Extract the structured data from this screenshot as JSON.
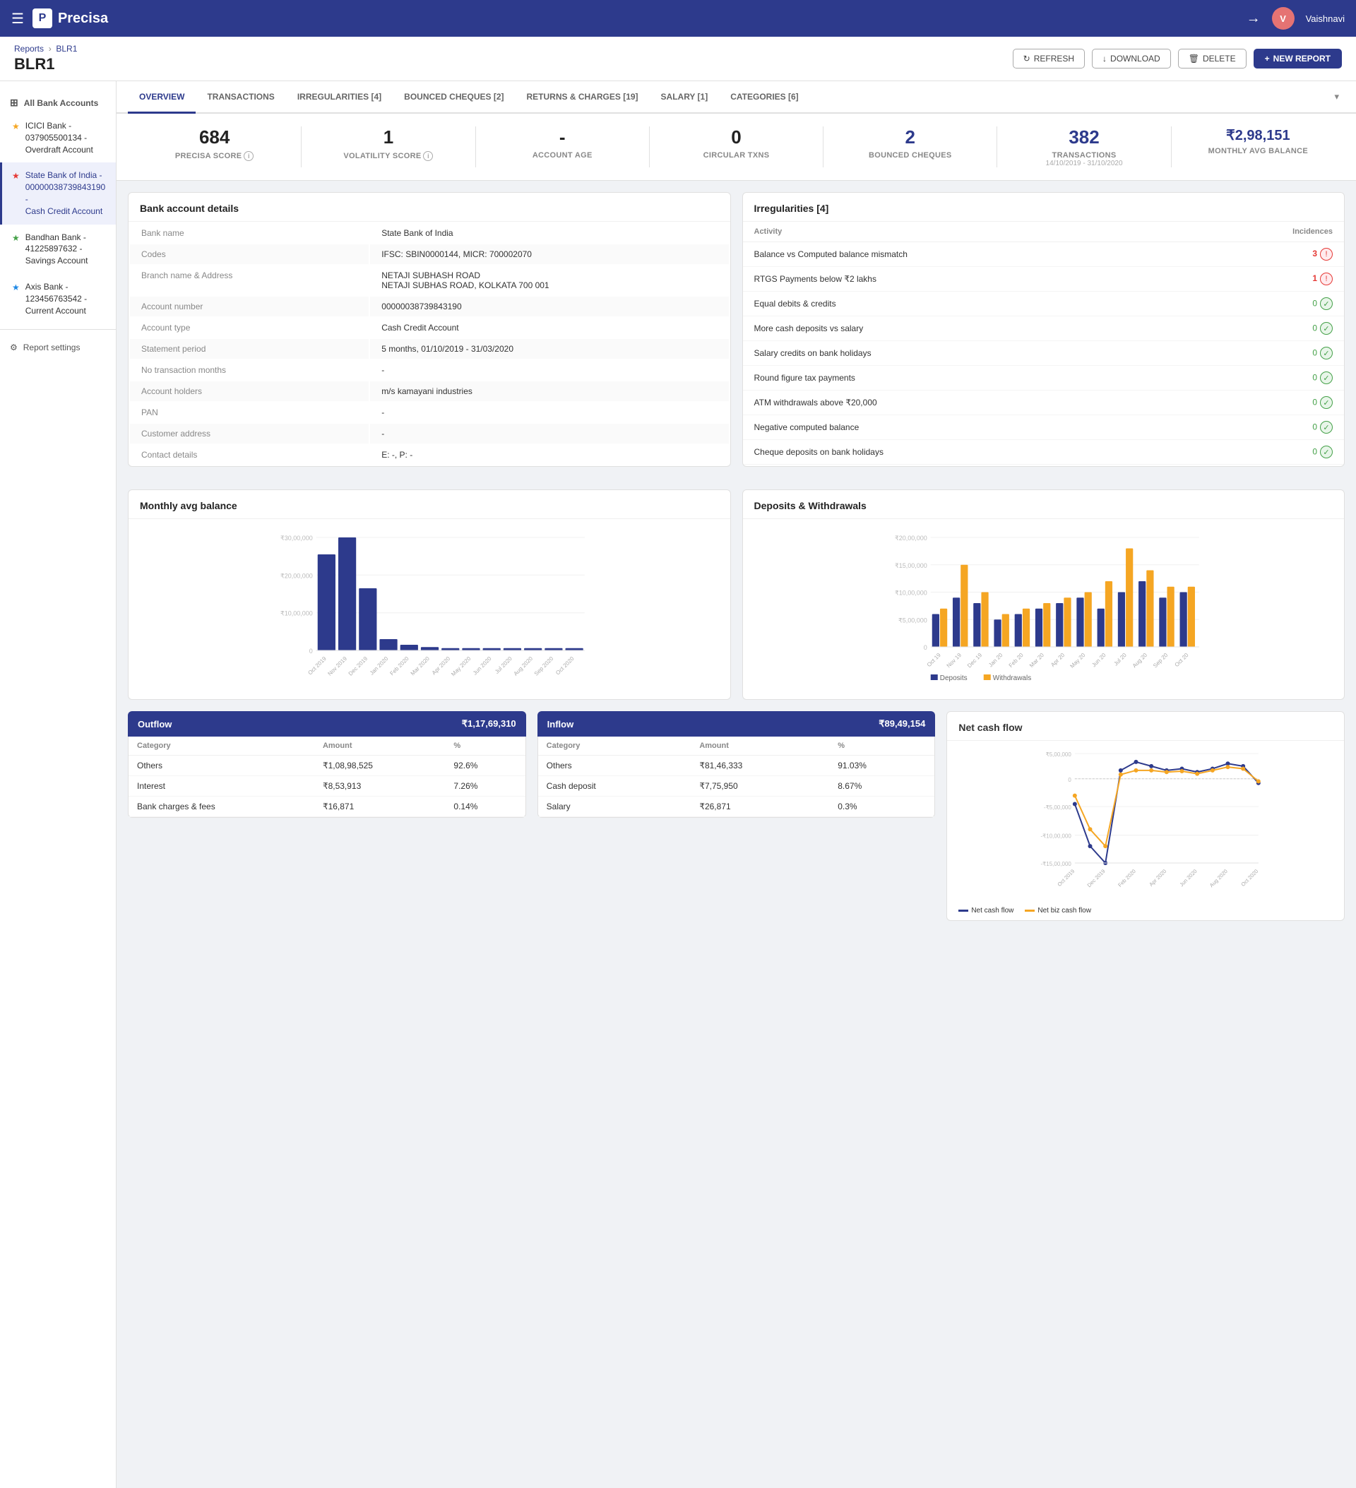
{
  "app": {
    "name": "Precisa",
    "user": "Vaishnavi"
  },
  "header": {
    "breadcrumb_parent": "Reports",
    "breadcrumb_child": "BLR1",
    "title": "BLR1",
    "actions": {
      "refresh": "REFRESH",
      "download": "DOWNLOAD",
      "delete": "DELETE",
      "new_report": "NEW REPORT"
    }
  },
  "sidebar": {
    "section_title": "All Bank Accounts",
    "items": [
      {
        "id": "icici",
        "label": "ICICI Bank - 037905500134 - Overdraft Account",
        "star": "gold",
        "active": false
      },
      {
        "id": "sbi",
        "label": "State Bank of India - 00000038739843190 - Cash Credit Account",
        "star": "red",
        "active": true
      },
      {
        "id": "bandhan",
        "label": "Bandhan Bank - 41225897632 - Savings Account",
        "star": "green",
        "active": false
      },
      {
        "id": "axis",
        "label": "Axis Bank - 123456763542 - Current Account",
        "star": "blue",
        "active": false
      }
    ],
    "settings": "Report settings"
  },
  "tabs": [
    {
      "id": "overview",
      "label": "OVERVIEW",
      "active": true
    },
    {
      "id": "transactions",
      "label": "TRANSACTIONS",
      "active": false
    },
    {
      "id": "irregularities",
      "label": "IRREGULARITIES [4]",
      "active": false
    },
    {
      "id": "bounced",
      "label": "BOUNCED CHEQUES [2]",
      "active": false
    },
    {
      "id": "returns",
      "label": "RETURNS & CHARGES [19]",
      "active": false
    },
    {
      "id": "salary",
      "label": "SALARY [1]",
      "active": false
    },
    {
      "id": "categories",
      "label": "CATEGORIES [6]",
      "active": false
    }
  ],
  "stats": [
    {
      "id": "precisa_score",
      "value": "684",
      "label": "PRECISA SCORE",
      "sub": "",
      "has_info": true,
      "blue": false
    },
    {
      "id": "volatility",
      "value": "1",
      "label": "VOLATILITY SCORE",
      "sub": "",
      "has_info": true,
      "blue": false
    },
    {
      "id": "account_age",
      "value": "-",
      "label": "ACCOUNT AGE",
      "sub": "",
      "has_info": false,
      "blue": false
    },
    {
      "id": "circular_txns",
      "value": "0",
      "label": "CIRCULAR TXNS",
      "sub": "",
      "has_info": false,
      "blue": false
    },
    {
      "id": "bounced_cheques",
      "value": "2",
      "label": "BOUNCED CHEQUES",
      "sub": "",
      "has_info": false,
      "blue": true
    },
    {
      "id": "transactions",
      "value": "382",
      "label": "TRANSACTIONS",
      "sub": "14/10/2019 - 31/10/2020",
      "has_info": false,
      "blue": true
    },
    {
      "id": "monthly_avg",
      "value": "₹2,98,151",
      "label": "MONTHLY AVG BALANCE",
      "sub": "",
      "has_info": false,
      "blue": true
    }
  ],
  "bank_details": {
    "title": "Bank account details",
    "rows": [
      {
        "label": "Bank name",
        "value": "State Bank of India"
      },
      {
        "label": "Codes",
        "value": "IFSC: SBIN0000144, MICR: 700002070"
      },
      {
        "label": "Branch name & Address",
        "value": "NETAJI SUBHASH ROAD\nNETAJI SUBHAS ROAD, KOLKATA 700 001"
      },
      {
        "label": "Account number",
        "value": "00000038739843190"
      },
      {
        "label": "Account type",
        "value": "Cash Credit Account"
      },
      {
        "label": "Statement period",
        "value": "5 months, 01/10/2019 - 31/03/2020"
      },
      {
        "label": "No transaction months",
        "value": "-"
      },
      {
        "label": "Account holders",
        "value": "m/s kamayani industries"
      },
      {
        "label": "PAN",
        "value": "-"
      },
      {
        "label": "Customer address",
        "value": "-"
      },
      {
        "label": "Contact details",
        "value": "E: -, P: -"
      }
    ]
  },
  "irregularities": {
    "title": "Irregularities [4]",
    "col_activity": "Activity",
    "col_incidences": "Incidences",
    "rows": [
      {
        "label": "Balance vs Computed balance mismatch",
        "value": 3,
        "status": "red"
      },
      {
        "label": "RTGS Payments below ₹2 lakhs",
        "value": 1,
        "status": "red"
      },
      {
        "label": "Equal debits & credits",
        "value": 0,
        "status": "green"
      },
      {
        "label": "More cash deposits vs salary",
        "value": 0,
        "status": "green"
      },
      {
        "label": "Salary credits on bank holidays",
        "value": 0,
        "status": "green"
      },
      {
        "label": "Round figure tax payments",
        "value": 0,
        "status": "green"
      },
      {
        "label": "ATM withdrawals above ₹20,000",
        "value": 0,
        "status": "green"
      },
      {
        "label": "Negative computed balance",
        "value": 0,
        "status": "green"
      },
      {
        "label": "Cheque deposits on bank holidays",
        "value": 0,
        "status": "green"
      }
    ]
  },
  "monthly_avg_chart": {
    "title": "Monthly avg balance",
    "y_labels": [
      "₹30,00,000",
      "₹20,00,000",
      "₹10,00,000",
      "0"
    ],
    "bars": [
      {
        "month": "Oct 2019",
        "value": 85,
        "height_pct": 0.85
      },
      {
        "month": "Nov 2019",
        "value": 100,
        "height_pct": 1.0
      },
      {
        "month": "Dec 2019",
        "value": 55,
        "height_pct": 0.55
      },
      {
        "month": "Jan 2020",
        "value": 10,
        "height_pct": 0.1
      },
      {
        "month": "Feb 2020",
        "value": 5,
        "height_pct": 0.05
      },
      {
        "month": "Mar 2020",
        "value": 3,
        "height_pct": 0.03
      },
      {
        "month": "Apr 2020",
        "value": 2,
        "height_pct": 0.02
      },
      {
        "month": "May 2020",
        "value": 2,
        "height_pct": 0.02
      },
      {
        "month": "Jun 2020",
        "value": 2,
        "height_pct": 0.02
      },
      {
        "month": "Jul 2020",
        "value": 2,
        "height_pct": 0.02
      },
      {
        "month": "Aug 2020",
        "value": 2,
        "height_pct": 0.02
      },
      {
        "month": "Sep 2020",
        "value": 2,
        "height_pct": 0.02
      },
      {
        "month": "Oct 2020",
        "value": 2,
        "height_pct": 0.02
      }
    ]
  },
  "deposits_chart": {
    "title": "Deposits & Withdrawals",
    "legend_deposits": "Deposits",
    "legend_withdrawals": "Withdrawals",
    "bars": [
      {
        "month": "Oct 19",
        "dep": 0.3,
        "with": 0.35
      },
      {
        "month": "Nov 19",
        "dep": 0.45,
        "with": 0.75
      },
      {
        "month": "Dec 19",
        "dep": 0.4,
        "with": 0.5
      },
      {
        "month": "Jan 20",
        "dep": 0.25,
        "with": 0.3
      },
      {
        "month": "Feb 20",
        "dep": 0.3,
        "with": 0.35
      },
      {
        "month": "Mar 20",
        "dep": 0.35,
        "with": 0.4
      },
      {
        "month": "Apr 20",
        "dep": 0.4,
        "with": 0.45
      },
      {
        "month": "May 20",
        "dep": 0.45,
        "with": 0.5
      },
      {
        "month": "Jun 20",
        "dep": 0.35,
        "with": 0.6
      },
      {
        "month": "Jul 20",
        "dep": 0.5,
        "with": 0.9
      },
      {
        "month": "Aug 20",
        "dep": 0.6,
        "with": 0.7
      },
      {
        "month": "Sep 20",
        "dep": 0.45,
        "with": 0.55
      },
      {
        "month": "Oct 20",
        "dep": 0.5,
        "with": 0.55
      }
    ]
  },
  "outflow": {
    "title": "Outflow",
    "total": "₹1,17,69,310",
    "col_category": "Category",
    "col_amount": "Amount",
    "col_pct": "%",
    "rows": [
      {
        "category": "Others",
        "amount": "₹1,08,98,525",
        "pct": "92.6%"
      },
      {
        "category": "Interest",
        "amount": "₹8,53,913",
        "pct": "7.26%"
      },
      {
        "category": "Bank charges & fees",
        "amount": "₹16,871",
        "pct": "0.14%"
      }
    ]
  },
  "inflow": {
    "title": "Inflow",
    "total": "₹89,49,154",
    "col_category": "Category",
    "col_amount": "Amount",
    "col_pct": "%",
    "rows": [
      {
        "category": "Others",
        "amount": "₹81,46,333",
        "pct": "91.03%"
      },
      {
        "category": "Cash deposit",
        "amount": "₹7,75,950",
        "pct": "8.67%"
      },
      {
        "category": "Salary",
        "amount": "₹26,871",
        "pct": "0.3%"
      }
    ]
  },
  "net_cashflow": {
    "title": "Net cash flow",
    "legend_net": "Net cash flow",
    "legend_biz": "Net biz cash flow",
    "y_labels": [
      "₹5,00,000",
      "0",
      "-₹5,00,000",
      "-₹10,00,000",
      "-₹15,00,000"
    ],
    "points": [
      {
        "month": "Oct 2019",
        "net": -0.3,
        "biz": -0.2
      },
      {
        "month": "Nov 2019",
        "net": -0.8,
        "biz": -0.6
      },
      {
        "month": "Dec 2019",
        "net": -1.0,
        "biz": -0.8
      },
      {
        "month": "Jan 2020",
        "net": 0.1,
        "biz": 0.05
      },
      {
        "month": "Feb 2020",
        "net": 0.2,
        "biz": 0.1
      },
      {
        "month": "Mar 2020",
        "net": 0.15,
        "biz": 0.1
      },
      {
        "month": "Apr 2020",
        "net": 0.1,
        "biz": 0.08
      },
      {
        "month": "May 2020",
        "net": 0.12,
        "biz": 0.09
      },
      {
        "month": "Jun 2020",
        "net": 0.08,
        "biz": 0.06
      },
      {
        "month": "Jul 2020",
        "net": 0.12,
        "biz": 0.1
      },
      {
        "month": "Aug 2020",
        "net": 0.18,
        "biz": 0.14
      },
      {
        "month": "Sep 2020",
        "net": 0.15,
        "biz": 0.12
      },
      {
        "month": "Oct 2020",
        "net": -0.05,
        "biz": -0.03
      }
    ]
  }
}
